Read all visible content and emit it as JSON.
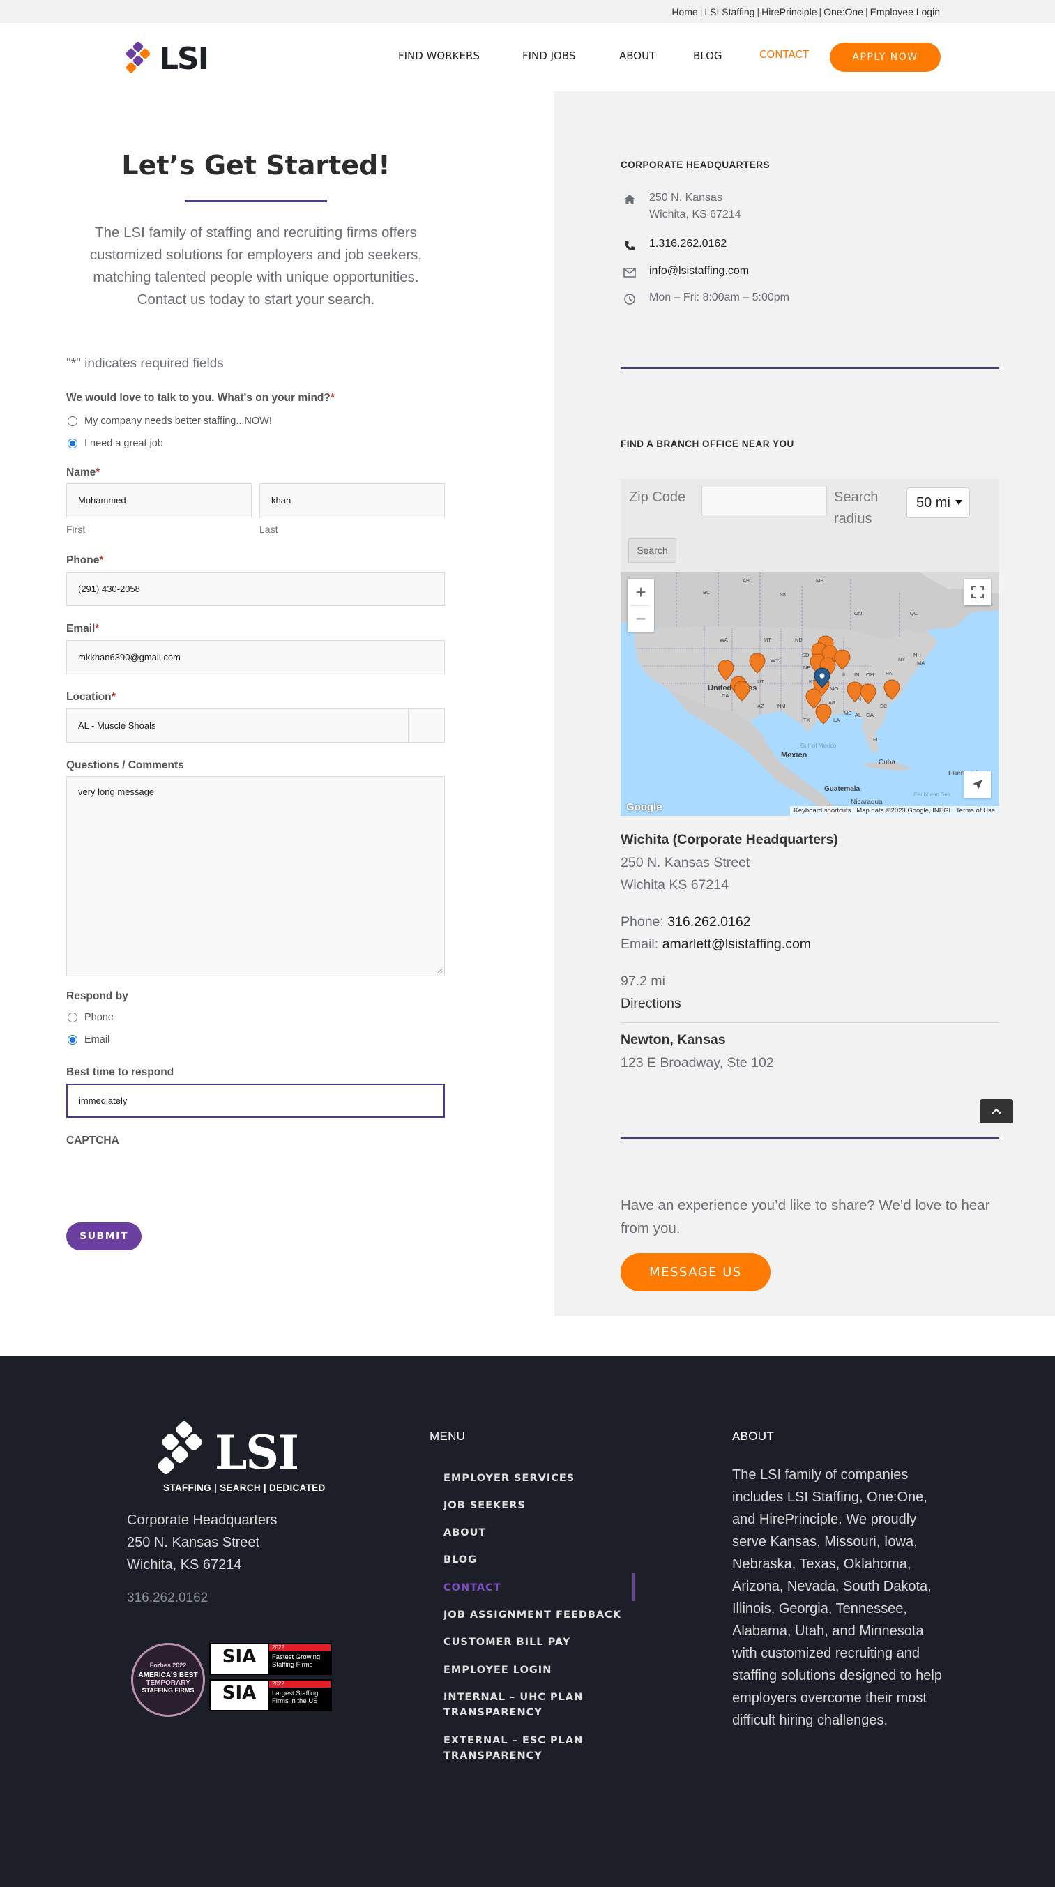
{
  "topbar": {
    "links": [
      "Home",
      "LSI Staffing",
      "HirePrinciple",
      "One:One",
      "Employee Login"
    ]
  },
  "header": {
    "logo_text": "LSI",
    "nav": [
      "FIND WORKERS",
      "FIND JOBS",
      "ABOUT",
      "BLOG",
      "CONTACT"
    ],
    "active_nav": "CONTACT",
    "apply_label": "APPLY NOW"
  },
  "hero": {
    "title": "Let’s Get Started!",
    "text": "The LSI family of staffing and recruiting firms offers customized solutions for employers and job seekers, matching talented people with unique opportunities. Contact us today to start your search."
  },
  "form": {
    "required_note": "\"*\" indicates required fields",
    "mind_label": "We would love to talk to you. What's on your mind?",
    "mind_options": [
      {
        "label": "My company needs better staffing...NOW!",
        "checked": false
      },
      {
        "label": "I need a great job",
        "checked": true
      }
    ],
    "name_label": "Name",
    "first_value": "Mohammed",
    "first_sub": "First",
    "last_value": "khan",
    "last_sub": "Last",
    "phone_label": "Phone",
    "phone_value": "(291) 430-2058",
    "email_label": "Email",
    "email_value": "mkkhan6390@gmail.com",
    "location_label": "Location",
    "location_value": "AL - Muscle Shoals",
    "comments_label": "Questions / Comments",
    "comments_value": "very long message",
    "respond_label": "Respond by",
    "respond_options": [
      {
        "label": "Phone",
        "checked": false
      },
      {
        "label": "Email",
        "checked": true
      }
    ],
    "best_time_label": "Best time to respond",
    "best_time_value": "immediately",
    "captcha_label": "CAPTCHA",
    "submit_label": "SUBMIT",
    "required_mark": "*"
  },
  "hq": {
    "heading": "CORPORATE HEADQUARTERS",
    "address_line1": "250 N. Kansas",
    "address_line2": "Wichita, KS 67214",
    "phone": "1.316.262.0162",
    "email": "info@lsistaffing.com",
    "hours": "Mon – Fri:  8:00am – 5:00pm"
  },
  "branch_finder": {
    "heading": "FIND A BRANCH OFFICE NEAR YOU",
    "zip_label": "Zip Code",
    "radius_label_1": "Search",
    "radius_label_2": "radius",
    "radius_value": "50 mi",
    "search_label": "Search",
    "map": {
      "labels": [
        "United States",
        "Mexico",
        "Cuba",
        "Puerto Rico",
        "Guatemala",
        "Nicaragua",
        "Gulf of Mexico",
        "Caribbean Sea",
        "ON",
        "QC",
        "BC",
        "AB",
        "SK",
        "MB",
        "WA",
        "MT",
        "ND",
        "SD",
        "WY",
        "NE",
        "CA",
        "NV",
        "UT",
        "AZ",
        "NM",
        "TX",
        "OK",
        "KS",
        "MO",
        "AR",
        "LA",
        "MS",
        "AL",
        "GA",
        "TN",
        "KY",
        "IL",
        "IN",
        "OH",
        "PA",
        "NY",
        "VA",
        "NC",
        "SC",
        "FL",
        "NH",
        "MA"
      ],
      "google": "Google",
      "attribution": [
        "Keyboard shortcuts",
        "Map data ©2023 Google, INEGI",
        "Terms of Use"
      ]
    },
    "results": [
      {
        "name": "Wichita (Corporate Headquarters)",
        "street": "250 N. Kansas Street",
        "city": "Wichita KS 67214",
        "phone_prefix": "Phone: ",
        "phone": "316.262.0162",
        "email_prefix": "Email: ",
        "email": "amarlett@lsistaffing.com",
        "distance": "97.2 mi",
        "directions": "Directions"
      },
      {
        "name": "Newton, Kansas",
        "street": "123 E Broadway, Ste 102"
      }
    ]
  },
  "share": {
    "text": "Have an experience you’d like to share? We’d love to hear from you.",
    "button": "MESSAGE US"
  },
  "footer": {
    "logo_text": "LSI",
    "tagline": "STAFFING | SEARCH | DEDICATED",
    "address": [
      "Corporate Headquarters",
      "250 N. Kansas Street",
      "Wichita, KS 67214"
    ],
    "phone": "316.262.0162",
    "forbes_badge": [
      "Forbes 2022",
      "AMERICA'S BEST",
      "TEMPORARY",
      "STAFFING FIRMS"
    ],
    "sia_badges": [
      {
        "year": "2022",
        "text": "Fastest Growing Staffing Firms"
      },
      {
        "year": "2022",
        "text": "Largest Staffing Firms in the US"
      }
    ],
    "sia_logo": "SIA",
    "menu_title": "MENU",
    "menu": [
      "EMPLOYER SERVICES",
      "JOB SEEKERS",
      "ABOUT",
      "BLOG",
      "CONTACT",
      "JOB ASSIGNMENT FEEDBACK",
      "CUSTOMER BILL PAY",
      "EMPLOYEE LOGIN",
      "INTERNAL – UHC PLAN TRANSPARENCY",
      "EXTERNAL – ESC PLAN TRANSPARENCY"
    ],
    "active_menu": "CONTACT",
    "about_title": "ABOUT",
    "about_text": "The LSI family of companies includes LSI Staffing, One:One, and HirePrinciple. We proudly serve Kansas, Missouri, Iowa, Nebraska, Texas, Oklahoma, Arizona, Nevada, South Dakota, Illinois, Georgia, Tennessee, Alabama, Utah, and Minnesota with customized recruiting and staffing solutions designed to help employers overcome their most difficult hiring challenges."
  },
  "colors": {
    "orange": "#ff7a00",
    "purple": "#6b3fa0",
    "navy_rule": "#4a3d8f",
    "footer_bg": "#1c1f27",
    "panel_gray": "#f2f2f2"
  }
}
